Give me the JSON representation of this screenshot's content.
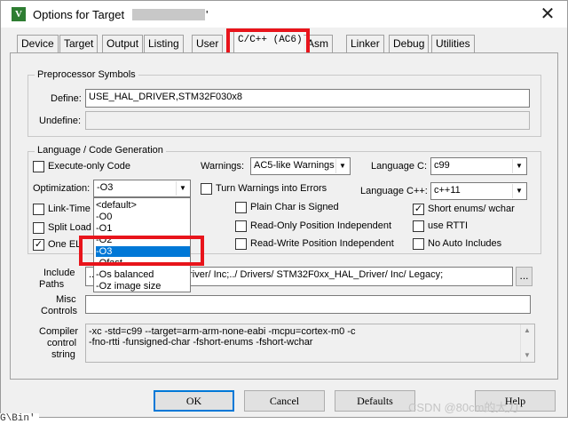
{
  "window": {
    "title_prefix": "Options for Target ",
    "title_suffix": "'",
    "app_icon_glyph": "V",
    "close_glyph": "✕"
  },
  "tabs": [
    "Device",
    "Target",
    "Output",
    "Listing",
    "User",
    "C/C++ (AC6)",
    "Asm",
    "Linker",
    "Debug",
    "Utilities"
  ],
  "active_tab": "C/C++ (AC6)",
  "preprocessor": {
    "group_label": "Preprocessor Symbols",
    "define_label": "Define:",
    "define_value": "USE_HAL_DRIVER,STM32F030x8",
    "undefine_label": "Undefine:",
    "undefine_value": ""
  },
  "language": {
    "group_label": "Language / Code Generation",
    "execute_only": {
      "label": "Execute-only Code",
      "checked": false
    },
    "optimization_label": "Optimization:",
    "optimization_value": "-O3",
    "link_time": {
      "label": "Link-Time O",
      "checked": false
    },
    "split_load": {
      "label": "Split Load",
      "checked": false
    },
    "one_elf": {
      "label": "One EL",
      "checked": true
    },
    "warnings_label": "Warnings:",
    "warnings_value": "AC5-like Warnings",
    "turn_warnings": {
      "label": "Turn Warnings into Errors",
      "checked": false
    },
    "plain_char": {
      "label": "Plain Char is Signed",
      "checked": false
    },
    "ro_pi": {
      "label": "Read-Only Position Independent",
      "checked": false
    },
    "rw_pi": {
      "label": "Read-Write Position Independent",
      "checked": false
    },
    "language_c_label": "Language C:",
    "language_c_value": "c99",
    "language_cpp_label": "Language C++:",
    "language_cpp_value": "c++11",
    "short_enums": {
      "label": "Short enums/ wchar",
      "checked": true
    },
    "use_rtti": {
      "label": "use RTTI",
      "checked": false
    },
    "no_auto_includes": {
      "label": "No Auto Includes",
      "checked": false
    }
  },
  "optimization_dropdown": {
    "options": [
      "<default>",
      "-O0",
      "-O1",
      "-O2",
      "-O3",
      "-Ofast",
      "-Os balanced",
      "-Oz image size"
    ],
    "selected": "-O3"
  },
  "include_paths": {
    "label_line1": "Include",
    "label_line2": "Paths",
    "value": "..; STM32F0xx_HAL_Driver/ Inc;../ Drivers/ STM32F0xx_HAL_Driver/ Inc/ Legacy;",
    "browse_label": "..."
  },
  "misc_controls": {
    "label_line1": "Misc",
    "label_line2": "Controls",
    "value": ""
  },
  "compiler_string": {
    "label_line1": "Compiler",
    "label_line2": "control",
    "label_line3": "string",
    "line1": "-xc -std=c99 --target=arm-arm-none-eabi -mcpu=cortex-m0 -c",
    "line2": "-fno-rtti -funsigned-char -fshort-enums -fshort-wchar"
  },
  "buttons": {
    "ok": "OK",
    "cancel": "Cancel",
    "defaults": "Defaults",
    "help": "Help"
  },
  "background_text": "G\\Bin'",
  "watermark": "CSDN @80cm的大刀",
  "colors": {
    "highlight": "#e8141b",
    "selection": "#0078d7"
  }
}
